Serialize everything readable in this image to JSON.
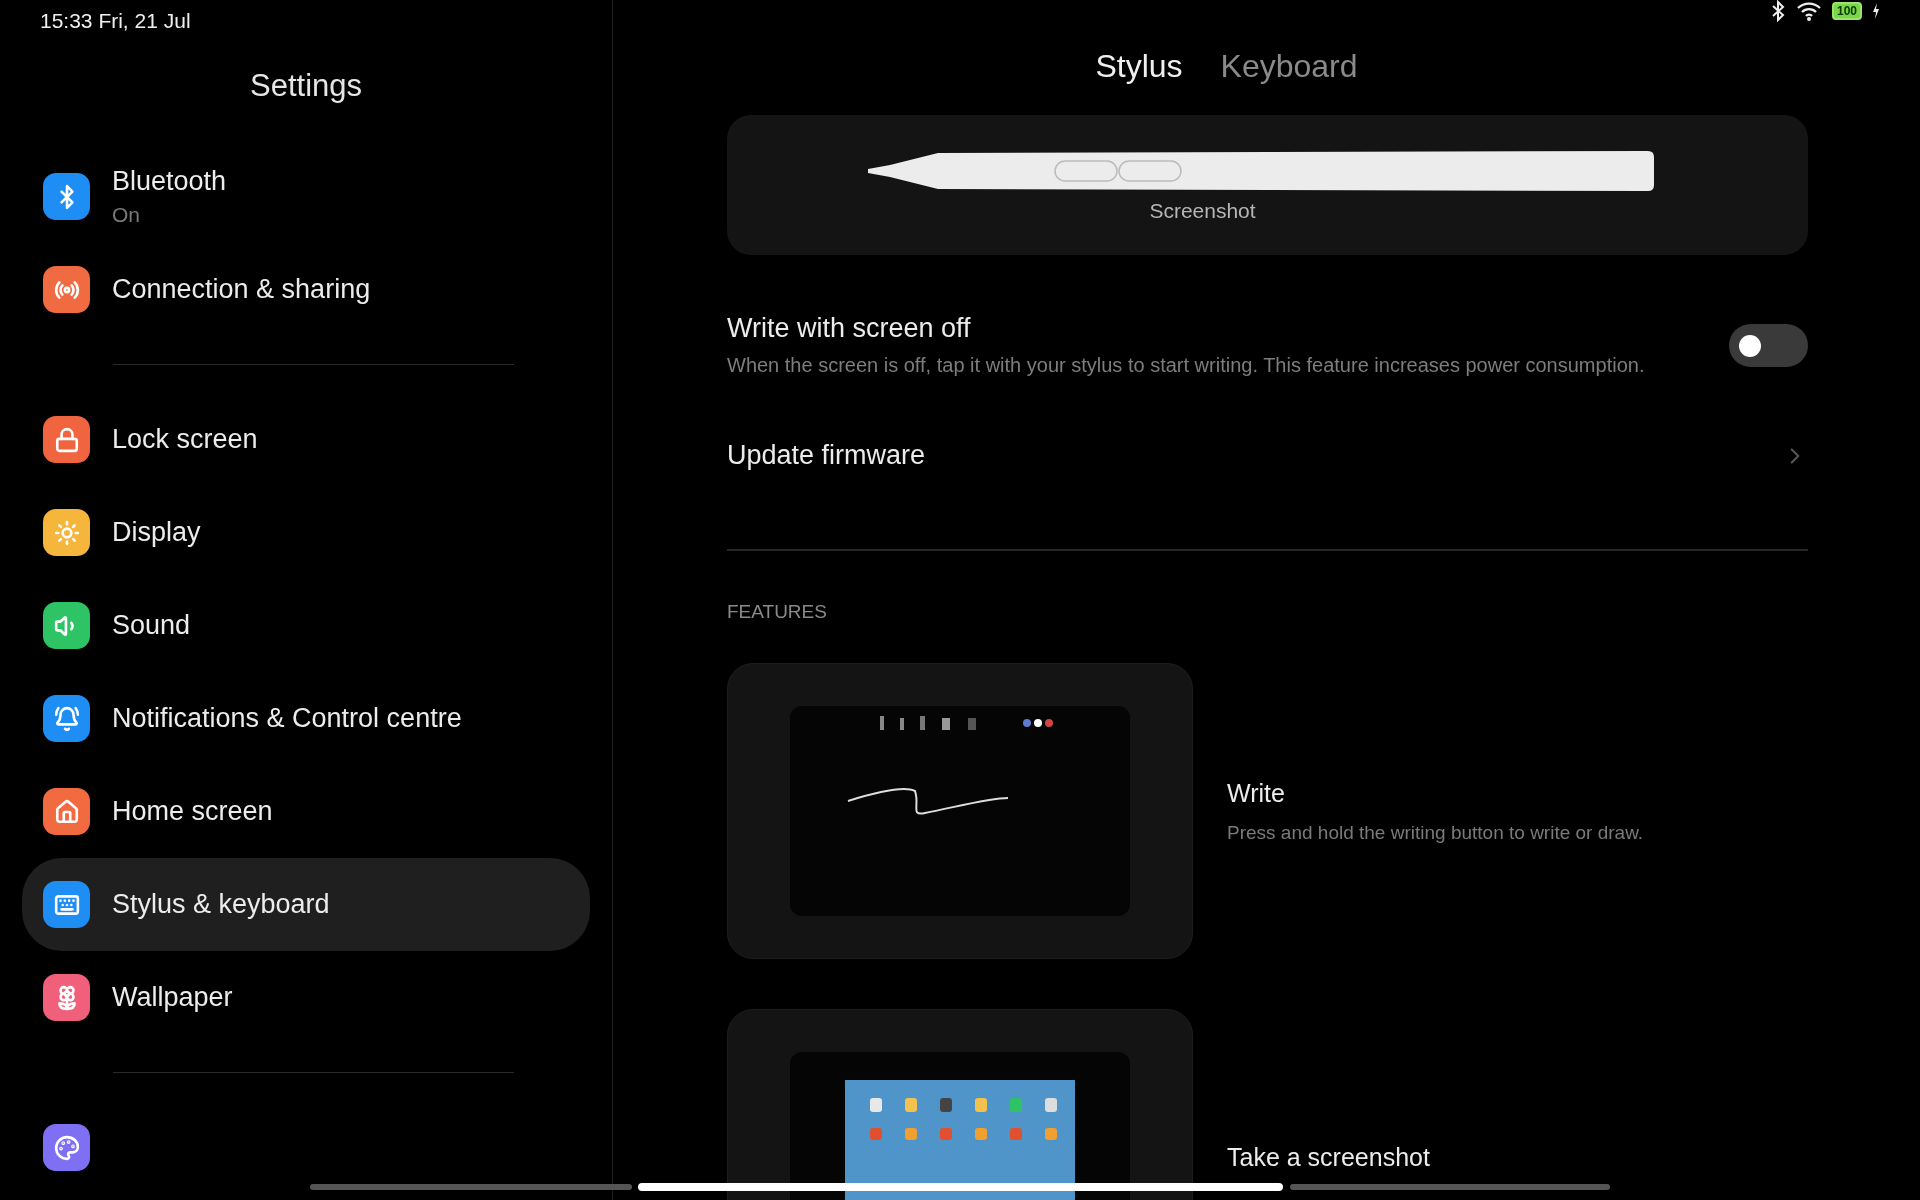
{
  "status_bar": {
    "time": "15:33 Fri, 21 Jul",
    "battery": "100"
  },
  "sidebar": {
    "title": "Settings",
    "groups": [
      [
        {
          "label": "Bluetooth",
          "sublabel": "On",
          "color": "#1e8ef5",
          "selected": false
        },
        {
          "label": "Connection & sharing",
          "color": "#f06a42",
          "selected": false
        }
      ],
      [
        {
          "label": "Lock screen",
          "color": "#f0653f",
          "selected": false
        },
        {
          "label": "Display",
          "color": "#f6b53b",
          "selected": false
        },
        {
          "label": "Sound",
          "color": "#2ec466",
          "selected": false
        },
        {
          "label": "Notifications & Control centre",
          "color": "#1e8ef5",
          "selected": false
        },
        {
          "label": "Home screen",
          "color": "#f26a3f",
          "selected": false
        },
        {
          "label": "Stylus & keyboard",
          "color": "#1e8ef5",
          "selected": true
        },
        {
          "label": "Wallpaper",
          "color": "#f0607a",
          "selected": false
        }
      ],
      [
        {
          "color": "#7f6ff3",
          "selected": false
        }
      ]
    ]
  },
  "tabs": [
    {
      "label": "Stylus",
      "selected": true
    },
    {
      "label": "Keyboard",
      "selected": false
    }
  ],
  "stylus_card": {
    "button_label": "Screenshot"
  },
  "settings": [
    {
      "kind": "toggle",
      "title": "Write with screen off",
      "description": "When the screen is off, tap it with your stylus to start writing. This feature increases power consumption.",
      "on": false
    },
    {
      "kind": "link",
      "title": "Update firmware"
    }
  ],
  "features": {
    "heading": "FEATURES",
    "items": [
      {
        "kind": "write",
        "title": "Write",
        "description": "Press and hold the writing button to write or draw."
      },
      {
        "kind": "screenshot",
        "title": "Take a screenshot"
      }
    ]
  }
}
